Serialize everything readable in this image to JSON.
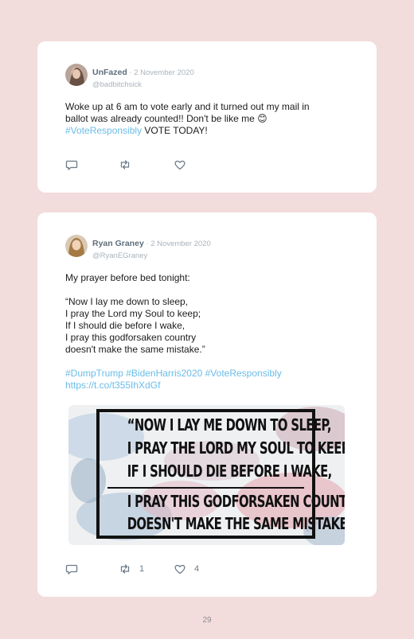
{
  "page_number": "29",
  "tweets": [
    {
      "name": "UnFazed",
      "date": " · 2 November 2020",
      "handle": "@badbitchsick",
      "lines": [
        "Woke up at 6 am to vote early and it turned out my mail in",
        "ballot was already counted!! Don't be like me 😊"
      ],
      "hashtag": "#VoteResponsibly",
      "after_hashtag": " VOTE TODAY!",
      "actions": {
        "reply_icon": "reply-icon",
        "retweet_icon": "retweet-icon",
        "like_icon": "heart-icon"
      }
    },
    {
      "name": "Ryan Graney",
      "date": " · 2 November 2020",
      "handle": "@RyanEGraney",
      "intro": "My prayer before bed tonight:",
      "poem": [
        "“Now I lay me down to sleep,",
        "I pray the Lord my Soul to keep;",
        "If I should die before I wake,",
        "I pray this godforsaken country",
        "doesn't make the same mistake.”"
      ],
      "hashtags": "#DumpTrump #BidenHarris2020 #VoteResponsibly",
      "link": "https://t.co/t355IhXdGf",
      "image_lines": [
        "“NOW I LAY ME DOWN TO SLEEP,",
        "I PRAY THE LORD MY SOUL TO KEEP;",
        "IF I SHOULD DIE BEFORE I WAKE,",
        "I PRAY THIS GODFORSAKEN COUNTRY",
        "DOESN'T MAKE THE SAME MISTAKE.”"
      ],
      "retweets": "1",
      "likes": "4"
    }
  ]
}
